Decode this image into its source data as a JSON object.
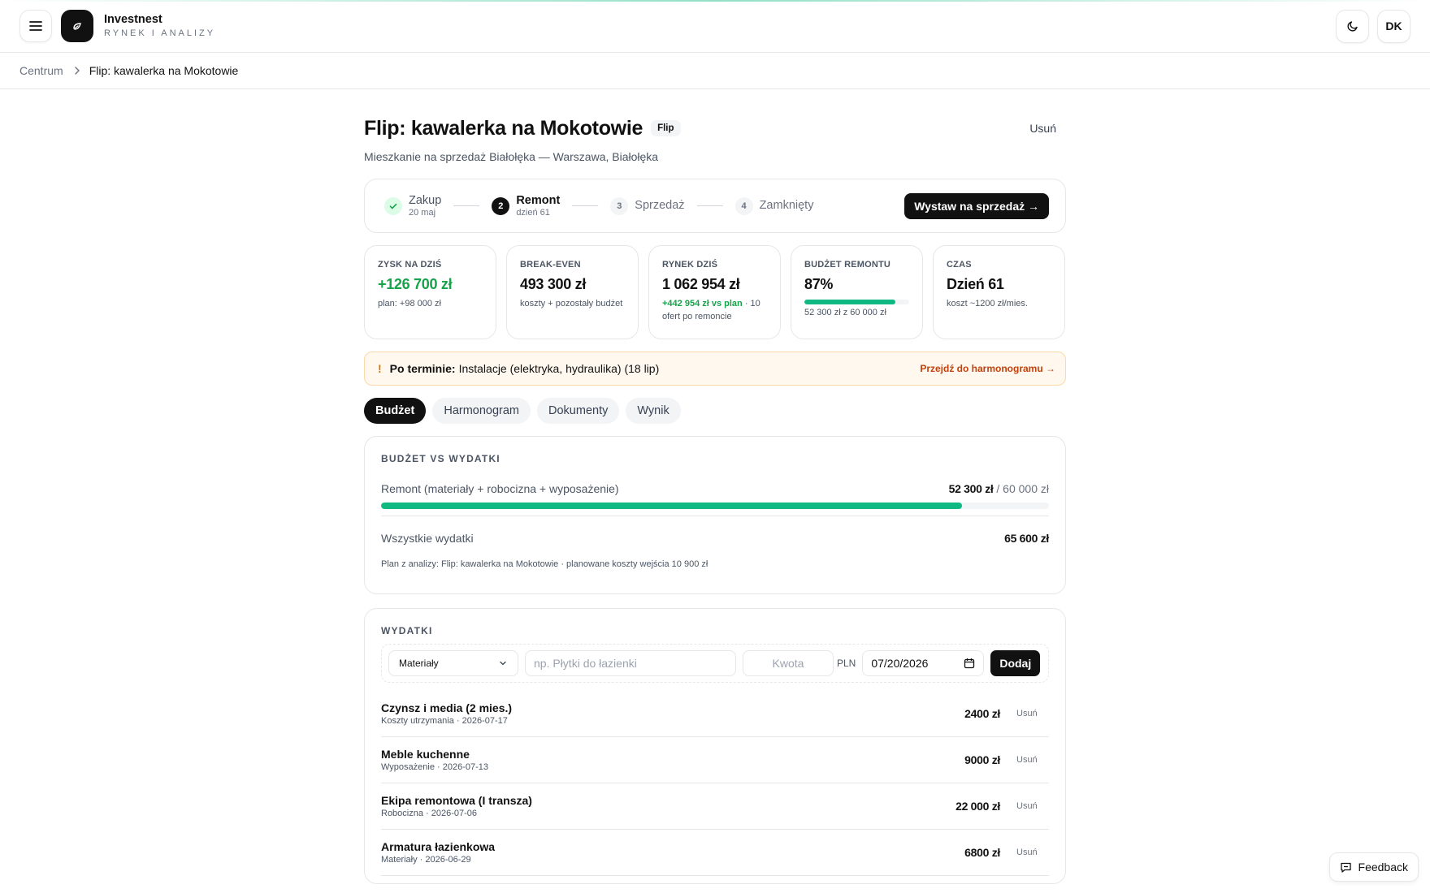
{
  "colors": {
    "accent_green": "#10b981",
    "positive_text": "#16a34a",
    "warning_bg": "#fff8ee",
    "warning_link": "#c2410c",
    "dark": "#111111"
  },
  "header": {
    "brand_name": "Investnest",
    "brand_sub": "RYNEK I ANALIZY",
    "avatar_initials": "DK",
    "icons": {
      "menu": "hamburger-icon",
      "logo": "leaf-logo-icon",
      "theme": "moon-icon"
    }
  },
  "breadcrumb": {
    "root": "Centrum",
    "current": "Flip: kawalerka na Mokotowie"
  },
  "project": {
    "title": "Flip: kawalerka na Mokotowie",
    "type_badge": "Flip",
    "delete_label": "Usuń",
    "subtitle": "Mieszkanie na sprzedaż Białołęka — Warszawa, Białołęka"
  },
  "stepper": {
    "steps": [
      {
        "label": "Zakup",
        "sub": "20 maj",
        "state": "done"
      },
      {
        "number": "2",
        "label": "Remont",
        "sub": "dzień 61",
        "state": "active"
      },
      {
        "number": "3",
        "label": "Sprzedaż",
        "state": "future"
      },
      {
        "number": "4",
        "label": "Zamknięty",
        "state": "future"
      }
    ],
    "action_label": "Wystaw na sprzedaż →"
  },
  "stats": {
    "profit": {
      "label": "ZYSK NA DZIŚ",
      "value": "+126 700 zł",
      "note": "plan: +98 000 zł"
    },
    "breakeven": {
      "label": "BREAK-EVEN",
      "value": "493 300 zł",
      "note": "koszty + pozostały budżet"
    },
    "market": {
      "label": "RYNEK DZIŚ",
      "value": "1 062 954 zł",
      "note_highlight": "+442 954 zł vs plan",
      "note_rest": " · 10 ofert po remoncie"
    },
    "budget": {
      "label": "BUDŻET REMONTU",
      "value": "87%",
      "progress": 0.87,
      "note": "52 300 zł z 60 000 zł"
    },
    "time": {
      "label": "CZAS",
      "value": "Dzień 61",
      "note": "koszt ~1200 zł/mies."
    }
  },
  "alert": {
    "icon": "!",
    "strong": "Po terminie:",
    "text": "Instalacje (elektryka, hydraulika) (18 lip)",
    "link": "Przejdź do harmonogramu →"
  },
  "tabs": [
    "Budżet",
    "Harmonogram",
    "Dokumenty",
    "Wynik"
  ],
  "active_tab": "Budżet",
  "budget": {
    "title": "BUDŻET VS WYDATKI",
    "row_label": "Remont (materiały + robocizna + wyposażenie)",
    "spent": "52 300 zł",
    "total": " / 60 000 zł",
    "progress": 0.87,
    "all_label": "Wszystkie wydatki",
    "all_value": "65 600 zł",
    "plan_note": "Plan z analizy: Flip: kawalerka na Mokotowie · planowane koszty wejścia 10 900 zł"
  },
  "expenses": {
    "title": "WYDATKI",
    "form": {
      "category_value": "Materiały",
      "desc_placeholder": "np. Płytki do łazienki",
      "amount_placeholder": "Kwota",
      "currency": "PLN",
      "date_value": "07/20/2026",
      "add_label": "Dodaj"
    },
    "items": [
      {
        "name": "Czynsz i media (2 mies.)",
        "meta": "Koszty utrzymania · 2026-07-17",
        "amount": "2400 zł",
        "delete": "Usuń"
      },
      {
        "name": "Meble kuchenne",
        "meta": "Wyposażenie · 2026-07-13",
        "amount": "9000 zł",
        "delete": "Usuń"
      },
      {
        "name": "Ekipa remontowa (I transza)",
        "meta": "Robocizna · 2026-07-06",
        "amount": "22 000 zł",
        "delete": "Usuń"
      },
      {
        "name": "Armatura łazienkowa",
        "meta": "Materiały · 2026-06-29",
        "amount": "6800 zł",
        "delete": "Usuń"
      }
    ]
  },
  "feedback_label": "Feedback"
}
